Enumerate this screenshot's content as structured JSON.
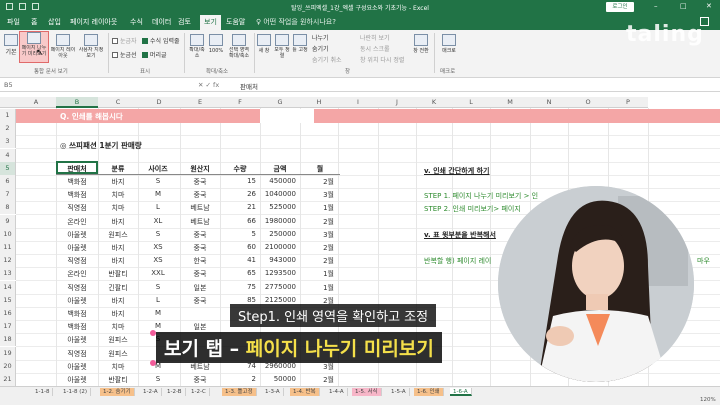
{
  "titlebar": {
    "title": "탈잉_쓰피엑셀_1강_엑셀 구성요소와 기초기능 - Excel",
    "login": "로그인",
    "min": "–",
    "max": "□",
    "close": "✕"
  },
  "menu": {
    "tabs": [
      "파일",
      "홈",
      "삽입",
      "페이지 레이아웃",
      "수식",
      "데이터",
      "검토",
      "보기",
      "도움말"
    ],
    "active": "보기",
    "search_placeholder": "♀ 어떤 작업을 원하시나요?"
  },
  "ribbon": {
    "view_group": {
      "normal": "기본",
      "page_break": "페이지 나누기 미리보기",
      "page_layout": "페이지 레이아웃",
      "custom": "사용자 지정 보기",
      "label": "통합 문서 보기"
    },
    "show_group": {
      "ruler": "눈금자",
      "gridlines": "눈금선",
      "formula_bar": "수식 입력줄",
      "headings": "머리글",
      "label": "표시"
    },
    "zoom_group": {
      "zoom": "확대/축소",
      "zoom100": "100%",
      "zoom_selection": "선택 영역 확대/축소",
      "label": "확대/축소"
    },
    "window_group": {
      "new_window": "새 창",
      "arrange_all": "모두 정렬",
      "freeze": "틀 고정",
      "split": "나누기",
      "hide": "숨기기",
      "unhide": "숨기기 취소",
      "side_by_side": "나란히 보기",
      "sync_scroll": "동시 스크롤",
      "reset_pos": "창 위치 다시 정렬",
      "switch": "창 전환",
      "label": "창"
    },
    "macro_group": {
      "macro": "매크로",
      "label": "매크로"
    }
  },
  "formula_bar": {
    "cell": "B5",
    "fx_icons": "✕  ✓  fx",
    "value": "판매처"
  },
  "columns": [
    "A",
    "B",
    "C",
    "D",
    "E",
    "F",
    "G",
    "H",
    "I",
    "J",
    "K",
    "L",
    "M",
    "N",
    "O",
    "P"
  ],
  "rows": [
    "1",
    "2",
    "3",
    "4",
    "5",
    "6",
    "7",
    "8",
    "9",
    "10",
    "11",
    "12",
    "13",
    "14",
    "15",
    "16",
    "17",
    "18",
    "19",
    "20",
    "21"
  ],
  "sheet": {
    "banner": "Q. 인쇄를 해봅시다",
    "subtitle": "◎ 쓰피패션 1분기 판매량",
    "headers": [
      "판매처",
      "분류",
      "사이즈",
      "원산지",
      "수량",
      "금액",
      "월"
    ],
    "data": [
      [
        "백화점",
        "바지",
        "S",
        "중국",
        "15",
        "450000",
        "2월"
      ],
      [
        "백화점",
        "치마",
        "M",
        "중국",
        "26",
        "1040000",
        "3월"
      ],
      [
        "직영점",
        "치마",
        "L",
        "베트남",
        "21",
        "525000",
        "1월"
      ],
      [
        "온라인",
        "바지",
        "XL",
        "베트남",
        "66",
        "1980000",
        "2월"
      ],
      [
        "아울렛",
        "원피스",
        "S",
        "중국",
        "5",
        "250000",
        "3월"
      ],
      [
        "아울렛",
        "바지",
        "XS",
        "중국",
        "60",
        "2100000",
        "2월"
      ],
      [
        "직영점",
        "바지",
        "XS",
        "한국",
        "41",
        "943000",
        "2월"
      ],
      [
        "온라인",
        "반팔티",
        "XXL",
        "중국",
        "65",
        "1293500",
        "1월"
      ],
      [
        "직영점",
        "긴팔티",
        "S",
        "일본",
        "75",
        "2775000",
        "1월"
      ],
      [
        "아울렛",
        "바지",
        "L",
        "중국",
        "85",
        "2125000",
        "2월"
      ],
      [
        "백화점",
        "바지",
        "M",
        "",
        "",
        "",
        ""
      ],
      [
        "백화점",
        "치마",
        "M",
        "일본",
        "",
        "",
        ""
      ],
      [
        "아울렛",
        "원피스",
        "S",
        "",
        "",
        "",
        ""
      ],
      [
        "직영점",
        "원피스",
        "",
        "",
        "",
        "",
        ""
      ],
      [
        "아울렛",
        "치마",
        "M",
        "베트남",
        "74",
        "2960000",
        "3월"
      ],
      [
        "아울렛",
        "반팔티",
        "S",
        "중국",
        "2",
        "50000",
        "2월"
      ]
    ],
    "notes": {
      "h1": "v. 인쇄 간단하게 하기",
      "s1": "STEP 1. 페이지 나누기 미리보기 > 인",
      "s2": "STEP 2. 인쇄 미리보기> 페이지",
      "h2": "v. 표 윗부분을 반복해서",
      "s3": "반복할 행) 페이지 레이",
      "s4": "마우"
    }
  },
  "sheet_tabs": [
    {
      "label": "1-1-8",
      "style": "plain"
    },
    {
      "label": "1-1-8 (2)",
      "style": "plain"
    },
    {
      "label": "1-2. 숨기기",
      "style": "orange"
    },
    {
      "label": "1-2-A",
      "style": "plain"
    },
    {
      "label": "1-2-B",
      "style": "plain"
    },
    {
      "label": "1-2-C",
      "style": "plain"
    },
    {
      "label": "1-3. 틀고정",
      "style": "orange"
    },
    {
      "label": "1-3-A",
      "style": "plain"
    },
    {
      "label": "1-4. 반복",
      "style": "orange"
    },
    {
      "label": "1-4-A",
      "style": "plain"
    },
    {
      "label": "1-5. 서식",
      "style": "pink"
    },
    {
      "label": "1-5-A",
      "style": "plain"
    },
    {
      "label": "1-6. 인쇄",
      "style": "orange"
    },
    {
      "label": "1-6-A",
      "style": "active"
    }
  ],
  "status": {
    "zoom": "120%"
  },
  "overlay": {
    "logo": "taling",
    "caption_step": "Step1. 인쇄 영역을 확인하고 조정",
    "caption_main_white": "보기 탭 – ",
    "caption_main_yellow": "페이지 나누기 미리보기"
  },
  "colors": {
    "excel_green": "#217346",
    "banner_pink": "#f4a6a6",
    "note_green": "#2e8b2e"
  }
}
